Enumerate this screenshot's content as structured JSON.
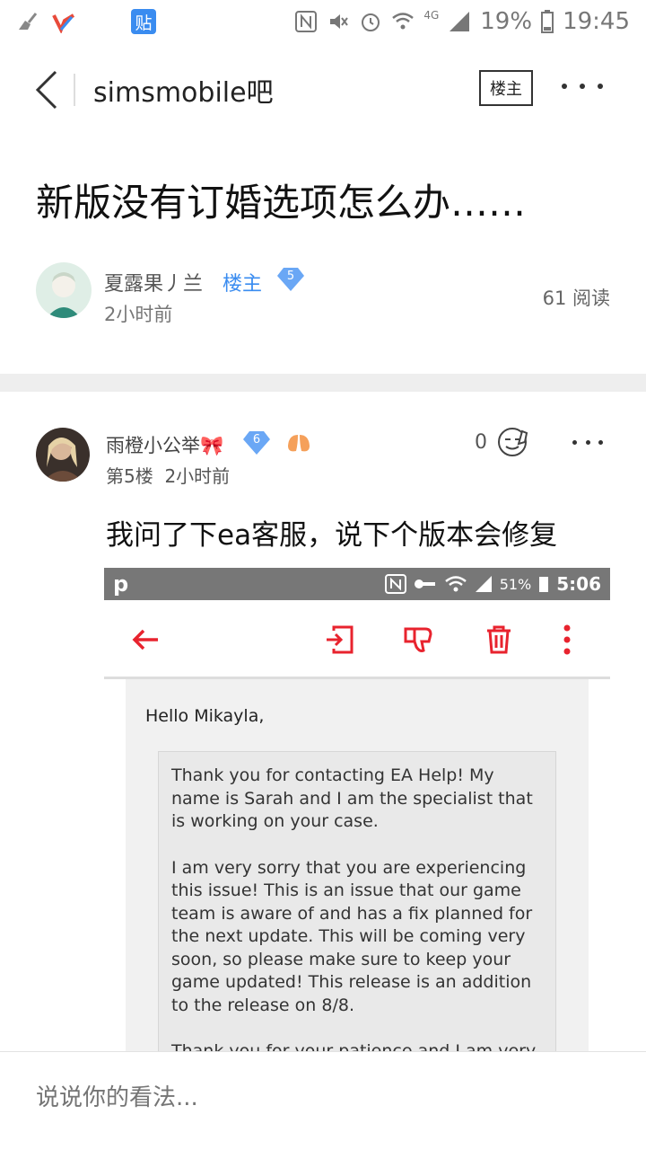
{
  "status_bar": {
    "battery": "19%",
    "time": "19:45",
    "network": "4G",
    "tieba_badge": "贴"
  },
  "header": {
    "title": "simsmobile吧",
    "louzhu_button": "楼主"
  },
  "post": {
    "title": "新版没有订婚选项怎么办……",
    "author": "夏露果丿兰",
    "author_tag": "楼主",
    "level": "5",
    "time": "2小时前",
    "read_count": "61 阅读"
  },
  "reply": {
    "user": "雨橙小公举🎀",
    "level": "6",
    "floor": "第5楼",
    "time": "2小时前",
    "likes": "0",
    "text": "我问了下ea客服，说下个版本会修复"
  },
  "embedded_screenshot": {
    "status_letter": "p",
    "battery": "51%",
    "time": "5:06",
    "greeting": "Hello Mikayla,",
    "paragraphs": [
      "Thank you for contacting EA Help! My name is Sarah and I am the specialist that is working on your case.",
      "I am very sorry that you are experiencing this issue! This is an issue that our game team is aware of and has a fix planned for the next update. This will be coming very soon, so please make sure to keep your game updated! This release is an addition to the release on 8/8.",
      "Thank you for your patience and I am very"
    ]
  },
  "comment": {
    "placeholder": "说说你的看法..."
  },
  "colors": {
    "accent_blue": "#3a8cf0",
    "gmail_red": "#e8232e",
    "separator": "#eeeeee"
  }
}
